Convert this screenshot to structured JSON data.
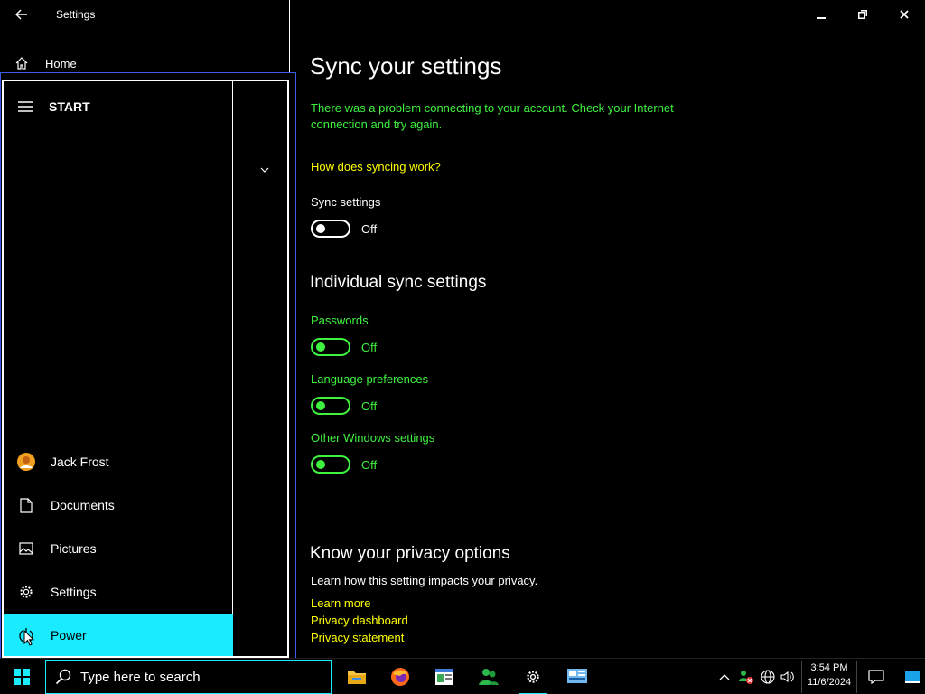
{
  "window": {
    "title": "Settings"
  },
  "nav": {
    "home_label": "Home"
  },
  "start_menu": {
    "header": "START",
    "items": [
      {
        "label": "Jack Frost",
        "icon": "user-avatar"
      },
      {
        "label": "Documents",
        "icon": "document-icon"
      },
      {
        "label": "Pictures",
        "icon": "pictures-icon"
      },
      {
        "label": "Settings",
        "icon": "gear-icon"
      },
      {
        "label": "Power",
        "icon": "power-icon"
      }
    ]
  },
  "main": {
    "title": "Sync your settings",
    "error_message": "There was a problem connecting to your account. Check your Internet connection and try again.",
    "how_link": "How does syncing work?",
    "sync_settings": {
      "label": "Sync settings",
      "state": "Off"
    },
    "individual_title": "Individual sync settings",
    "individual": [
      {
        "label": "Passwords",
        "state": "Off"
      },
      {
        "label": "Language preferences",
        "state": "Off"
      },
      {
        "label": "Other Windows settings",
        "state": "Off"
      }
    ],
    "privacy_title": "Know your privacy options",
    "privacy_text": "Learn how this setting impacts your privacy.",
    "privacy_links": [
      "Learn more",
      "Privacy dashboard",
      "Privacy statement"
    ]
  },
  "taskbar": {
    "search_placeholder": "Type here to search",
    "time": "3:54 PM",
    "date": "11/6/2024"
  },
  "colors": {
    "accent": "#1aebff",
    "green": "#3ff23f",
    "link": "#ffff00"
  }
}
